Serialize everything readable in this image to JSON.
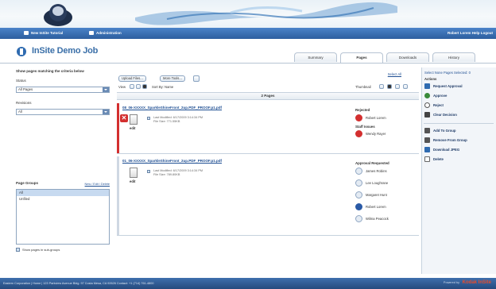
{
  "nav": {
    "home": "New InSite Tutorial",
    "admin": "Administration",
    "right": "Robert Lorem  Help  Logout"
  },
  "job": {
    "title": "InSite Demo Job"
  },
  "tabs": [
    {
      "label": "Summary"
    },
    {
      "label": "Pages"
    },
    {
      "label": "Downloads"
    },
    {
      "label": "History"
    }
  ],
  "left": {
    "filter_label": "Show pages matching the criteria below",
    "status_label": "Status",
    "status_value": "All Pages",
    "revisions_label": "Revisions",
    "revisions_value": "All",
    "page_groups_label": "Page Groups",
    "page_groups_link": "New / Edit / Delete",
    "groups": [
      {
        "label": "All",
        "selected": true
      },
      {
        "label": "Unfiled",
        "selected": false
      }
    ],
    "show_pages_label": "Show pages in sub-groups"
  },
  "toolbar": {
    "upload": "Upload Files...",
    "more": "More Tools...",
    "view_label": "View",
    "sort_label": "Sort By: Name",
    "select_all": "Select All",
    "thumbnail": "Thumbnail",
    "pages_count": "2 Pages",
    "selector_right": "Select None  Pages Selected: 0"
  },
  "items": [
    {
      "filename": "08_06-XXXXX_SparkleShineFront_2up.PDF_PROOF.p1.pdf",
      "hint_line1": "Last Modified: 6/17/2009 3:14:34 PM",
      "hint_line2": "File Size: 771.55KB",
      "thumb_label": "edit",
      "status_title": "Rejected",
      "status_person": "Robert Lorem",
      "status_title2": "Staff Issues",
      "status_person2": "Wendy Rayer"
    },
    {
      "filename": "01_06-XXXXX_SparkleShineFront_2up.PDF_PROOF.p1.pdf",
      "hint_line1": "Last Modified: 6/17/2009 3:14:34 PM",
      "hint_line2": "File Size: 789.80KB",
      "thumb_label": "edit",
      "status_title": "Approval Requested",
      "people": [
        {
          "name": "James Robins"
        },
        {
          "name": "Lee Loughrane"
        },
        {
          "name": "Margaret Hunt"
        },
        {
          "name": "Robert Lorem"
        },
        {
          "name": "Wilma Peacock"
        }
      ]
    }
  ],
  "actions": {
    "header": "Actions",
    "items": [
      {
        "label": "Request Approval"
      },
      {
        "label": "Approve"
      },
      {
        "label": "Reject"
      },
      {
        "label": "Clear Decision"
      },
      {
        "label": "Add To Group"
      },
      {
        "label": "Remove From Group"
      },
      {
        "label": "Download JPEG"
      },
      {
        "label": "Delete"
      }
    ]
  },
  "footer": {
    "text": "Eastern Corporation  |  Home  |  123 Parkview Avenue Bldg. 97 Costa Mesa, CA 92626 Contact: +1 (714) 761-4800",
    "powered": "Powered by",
    "brand": "Kodak InSite"
  }
}
